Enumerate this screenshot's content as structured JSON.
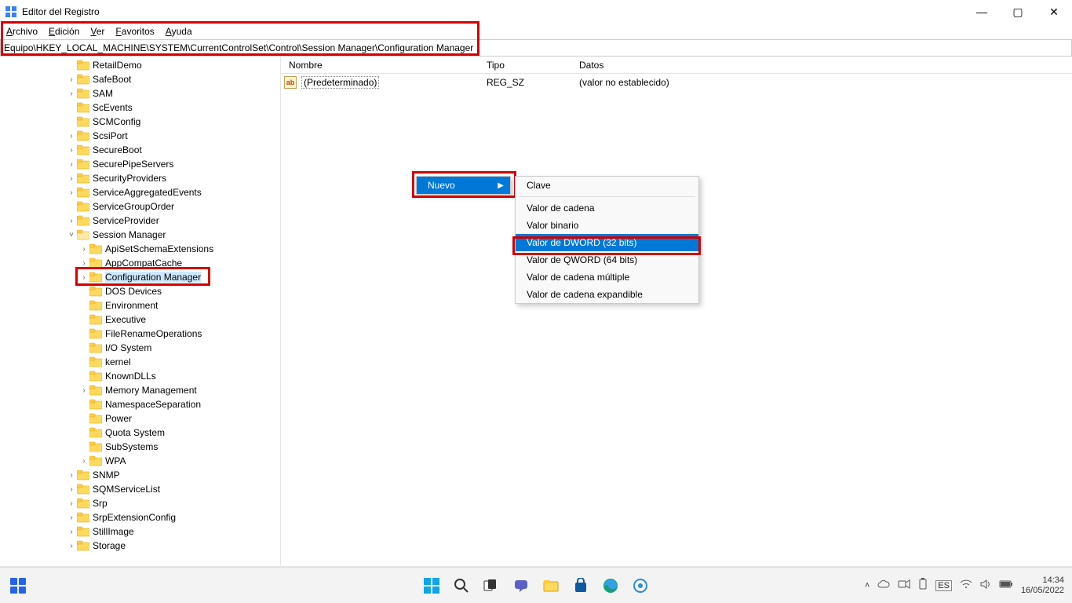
{
  "window": {
    "title": "Editor del Registro",
    "minimize": "—",
    "maximize": "▢",
    "close": "✕"
  },
  "menubar": {
    "items": [
      "Archivo",
      "Edición",
      "Ver",
      "Favoritos",
      "Ayuda"
    ]
  },
  "addressbar": {
    "path": "Equipo\\HKEY_LOCAL_MACHINE\\SYSTEM\\CurrentControlSet\\Control\\Session Manager\\Configuration Manager"
  },
  "tree": {
    "items": [
      {
        "indent": 5,
        "chev": "",
        "label": "RetailDemo"
      },
      {
        "indent": 5,
        "chev": ">",
        "label": "SafeBoot"
      },
      {
        "indent": 5,
        "chev": ">",
        "label": "SAM"
      },
      {
        "indent": 5,
        "chev": "",
        "label": "ScEvents"
      },
      {
        "indent": 5,
        "chev": "",
        "label": "SCMConfig"
      },
      {
        "indent": 5,
        "chev": ">",
        "label": "ScsiPort"
      },
      {
        "indent": 5,
        "chev": ">",
        "label": "SecureBoot"
      },
      {
        "indent": 5,
        "chev": ">",
        "label": "SecurePipeServers"
      },
      {
        "indent": 5,
        "chev": ">",
        "label": "SecurityProviders"
      },
      {
        "indent": 5,
        "chev": ">",
        "label": "ServiceAggregatedEvents"
      },
      {
        "indent": 5,
        "chev": "",
        "label": "ServiceGroupOrder"
      },
      {
        "indent": 5,
        "chev": ">",
        "label": "ServiceProvider"
      },
      {
        "indent": 5,
        "chev": "v",
        "label": "Session Manager",
        "open": true
      },
      {
        "indent": 6,
        "chev": ">",
        "label": "ApiSetSchemaExtensions"
      },
      {
        "indent": 6,
        "chev": ">",
        "label": "AppCompatCache"
      },
      {
        "indent": 6,
        "chev": ">",
        "label": "Configuration Manager",
        "selected": true,
        "hl": true
      },
      {
        "indent": 6,
        "chev": "",
        "label": "DOS Devices"
      },
      {
        "indent": 6,
        "chev": "",
        "label": "Environment"
      },
      {
        "indent": 6,
        "chev": "",
        "label": "Executive"
      },
      {
        "indent": 6,
        "chev": "",
        "label": "FileRenameOperations"
      },
      {
        "indent": 6,
        "chev": "",
        "label": "I/O System"
      },
      {
        "indent": 6,
        "chev": "",
        "label": "kernel"
      },
      {
        "indent": 6,
        "chev": "",
        "label": "KnownDLLs"
      },
      {
        "indent": 6,
        "chev": ">",
        "label": "Memory Management"
      },
      {
        "indent": 6,
        "chev": "",
        "label": "NamespaceSeparation"
      },
      {
        "indent": 6,
        "chev": "",
        "label": "Power"
      },
      {
        "indent": 6,
        "chev": "",
        "label": "Quota System"
      },
      {
        "indent": 6,
        "chev": "",
        "label": "SubSystems"
      },
      {
        "indent": 6,
        "chev": ">",
        "label": "WPA"
      },
      {
        "indent": 5,
        "chev": ">",
        "label": "SNMP"
      },
      {
        "indent": 5,
        "chev": ">",
        "label": "SQMServiceList"
      },
      {
        "indent": 5,
        "chev": ">",
        "label": "Srp"
      },
      {
        "indent": 5,
        "chev": ">",
        "label": "SrpExtensionConfig"
      },
      {
        "indent": 5,
        "chev": ">",
        "label": "StillImage"
      },
      {
        "indent": 5,
        "chev": ">",
        "label": "Storage"
      }
    ]
  },
  "list": {
    "columns": {
      "name": "Nombre",
      "type": "Tipo",
      "data": "Datos"
    },
    "rows": [
      {
        "name": "(Predeterminado)",
        "type": "REG_SZ",
        "data": "(valor no establecido)"
      }
    ]
  },
  "ctx1": {
    "items": [
      {
        "label": "Nuevo",
        "hov": true,
        "arrow": true
      }
    ]
  },
  "ctx2": {
    "items": [
      {
        "label": "Clave"
      },
      {
        "sep": true
      },
      {
        "label": "Valor de cadena"
      },
      {
        "label": "Valor binario"
      },
      {
        "label": "Valor de DWORD (32 bits)",
        "hov": true,
        "hl": true
      },
      {
        "label": "Valor de QWORD (64 bits)"
      },
      {
        "label": "Valor de cadena múltiple"
      },
      {
        "label": "Valor de cadena expandible"
      }
    ]
  },
  "taskbar": {
    "time": "14:34",
    "date": "16/05/2022"
  }
}
